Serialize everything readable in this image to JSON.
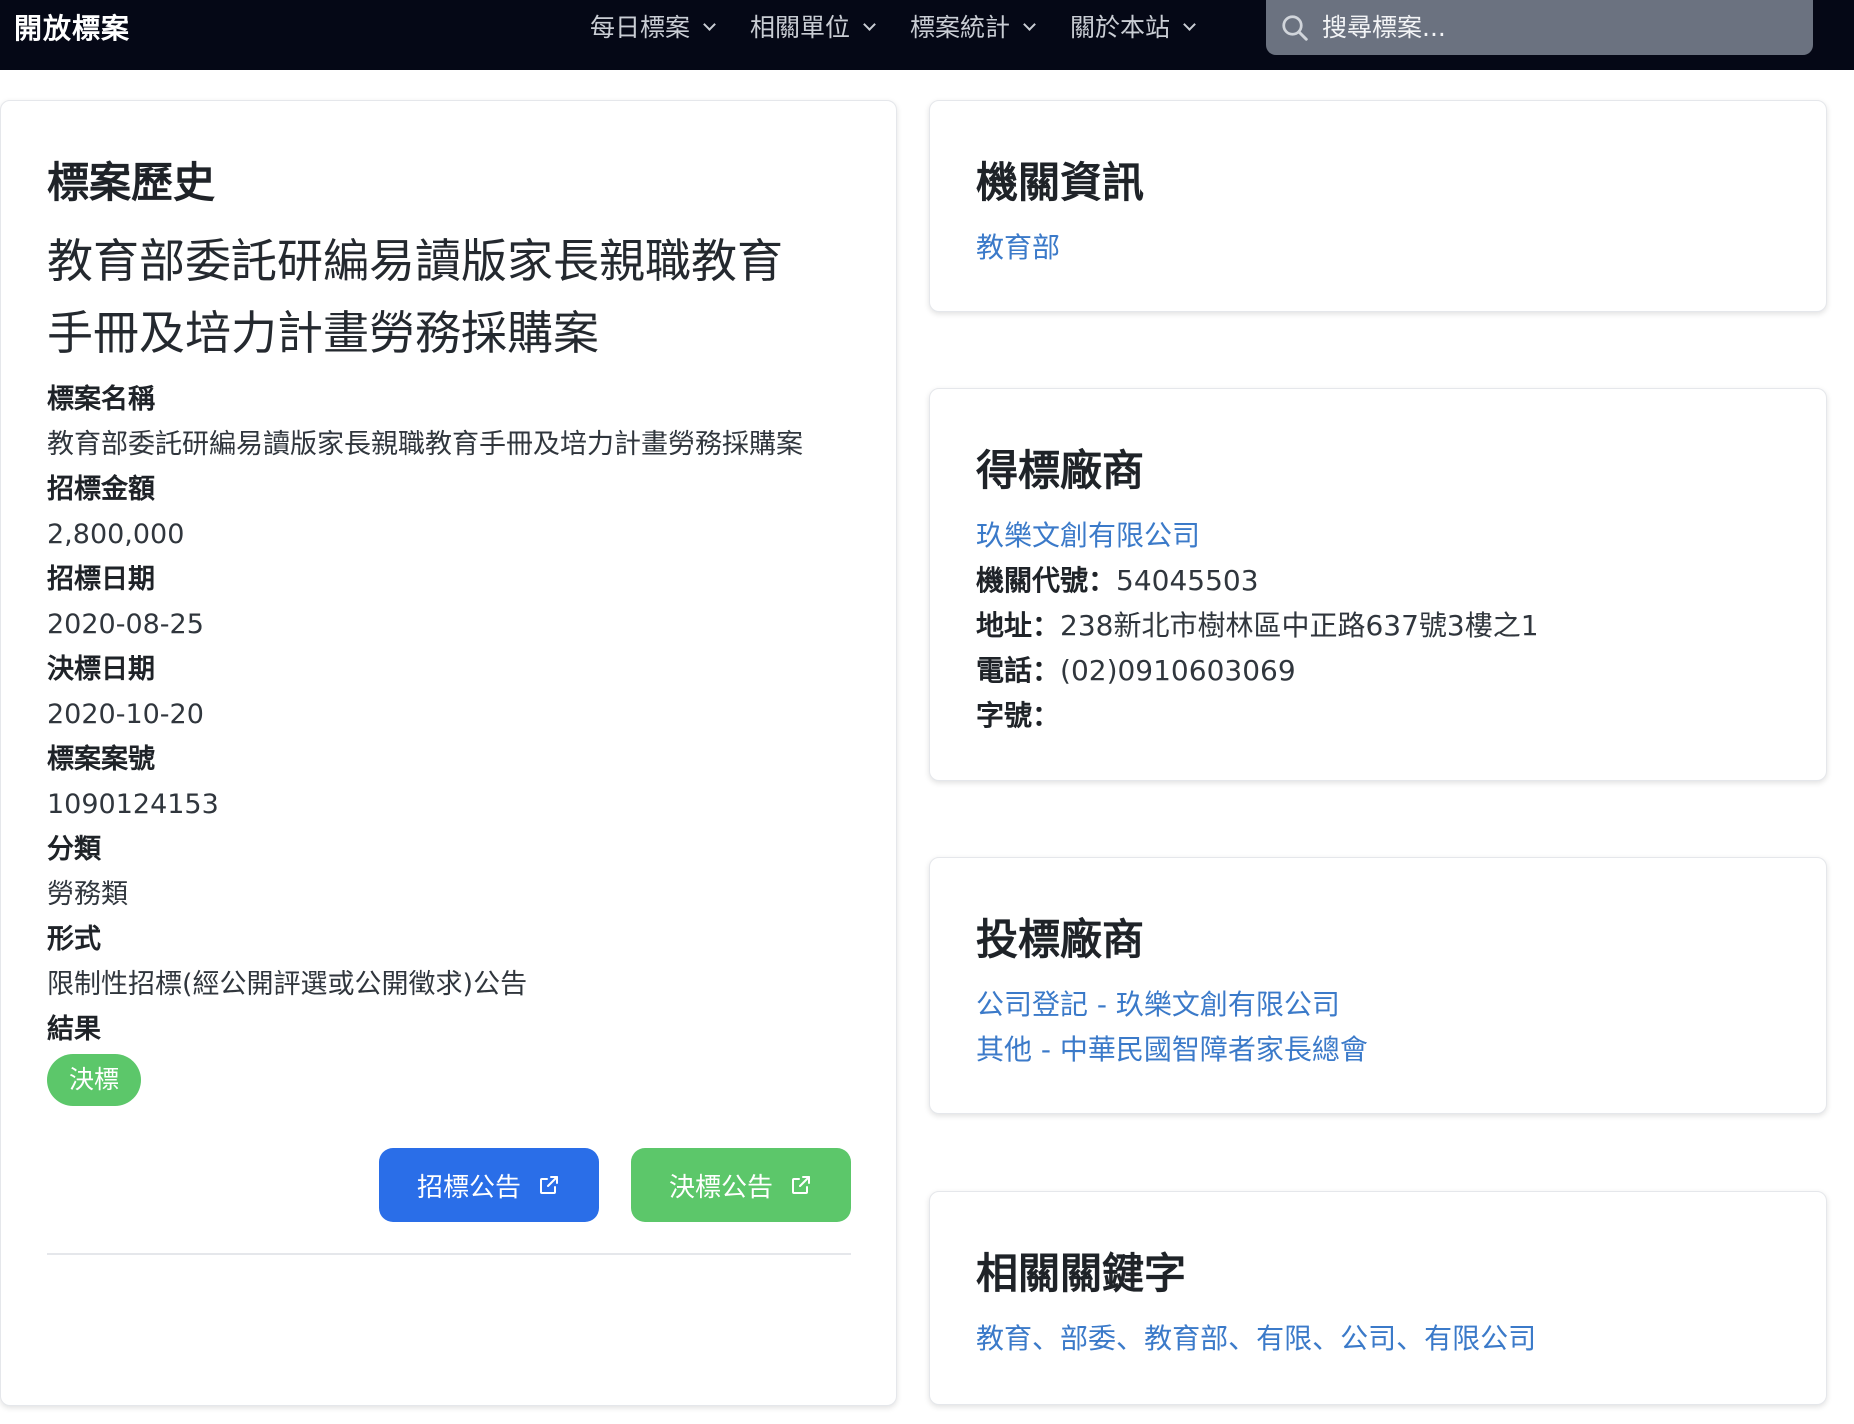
{
  "navbar": {
    "brand": "開放標案",
    "menu": [
      {
        "label": "每日標案"
      },
      {
        "label": "相關單位"
      },
      {
        "label": "標案統計"
      },
      {
        "label": "關於本站"
      }
    ],
    "search_placeholder": "搜尋標案..."
  },
  "history": {
    "heading": "標案歷史",
    "title": "教育部委託研編易讀版家長親職教育手冊及培力計畫勞務採購案",
    "fields": [
      {
        "label": "標案名稱",
        "value": "教育部委託研編易讀版家長親職教育手冊及培力計畫勞務採購案"
      },
      {
        "label": "招標金額",
        "value": "2,800,000"
      },
      {
        "label": "招標日期",
        "value": "2020-08-25"
      },
      {
        "label": "決標日期",
        "value": "2020-10-20"
      },
      {
        "label": "標案案號",
        "value": "1090124153"
      },
      {
        "label": "分類",
        "value": "勞務類"
      },
      {
        "label": "形式",
        "value": "限制性招標(經公開評選或公開徵求)公告"
      }
    ],
    "result_label": "結果",
    "result_badge": "決標",
    "btn_tender": "招標公告",
    "btn_award": "決標公告"
  },
  "agency": {
    "heading": "機關資訊",
    "name": "教育部"
  },
  "winner": {
    "heading": "得標廠商",
    "name": "玖樂文創有限公司",
    "id_label": "機關代號：",
    "id_value": "54045503",
    "address_label": "地址：",
    "address_value": "238新北市樹林區中正路637號3樓之1",
    "phone_label": "電話：",
    "phone_value": "(02)0910603069",
    "serial_label": "字號：",
    "serial_value": ""
  },
  "bidders": {
    "heading": "投標廠商",
    "items": [
      "公司登記 - 玖樂文創有限公司",
      "其他 - 中華民國智障者家長總會"
    ]
  },
  "keywords": {
    "heading": "相關關鍵字",
    "separator": "、",
    "items": [
      "教育",
      "部委",
      "教育部",
      "有限",
      "公司",
      "有限公司"
    ]
  },
  "colors": {
    "navbar_bg": "#050816",
    "link": "#3b7ac9",
    "primary_button": "#2a6ee8",
    "success": "#5cc76a"
  }
}
